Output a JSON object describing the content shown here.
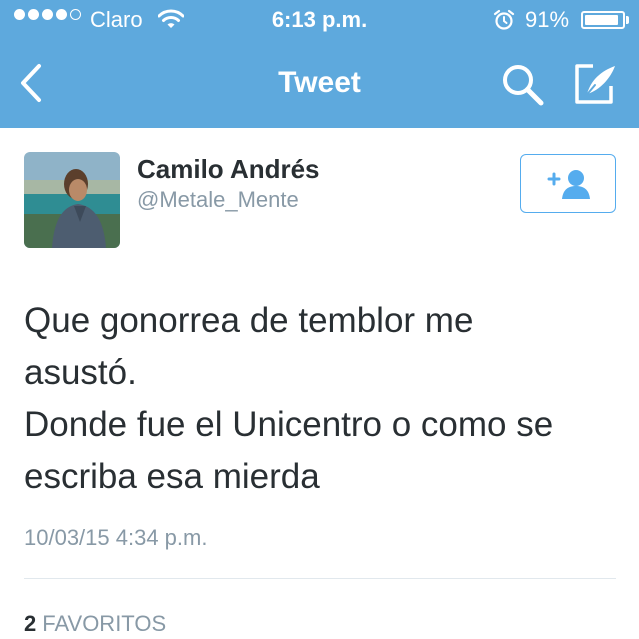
{
  "status_bar": {
    "carrier": "Claro",
    "time": "6:13 p.m.",
    "battery": "91%",
    "battery_level": 0.91,
    "signal_bars_filled": 4,
    "signal_bars_total": 5
  },
  "nav": {
    "title": "Tweet",
    "back_icon": "chevron-left-icon",
    "search_icon": "search-icon",
    "compose_icon": "compose-icon"
  },
  "tweet": {
    "author_name": "Camilo Andrés",
    "author_handle": "@Metale_Mente",
    "follow_icon": "add-user-icon",
    "text": "Que gonorrea de temblor me\nasustó.\nDonde fue el Unicentro o como se\nescriba esa mierda",
    "timestamp": "10/03/15 4:34 p.m.",
    "favorites_count": "2",
    "favorites_label": "FAVORITOS"
  },
  "colors": {
    "header": "#5ea9dd",
    "accent": "#55acee",
    "text": "#292f33",
    "muted": "#8899a6"
  }
}
